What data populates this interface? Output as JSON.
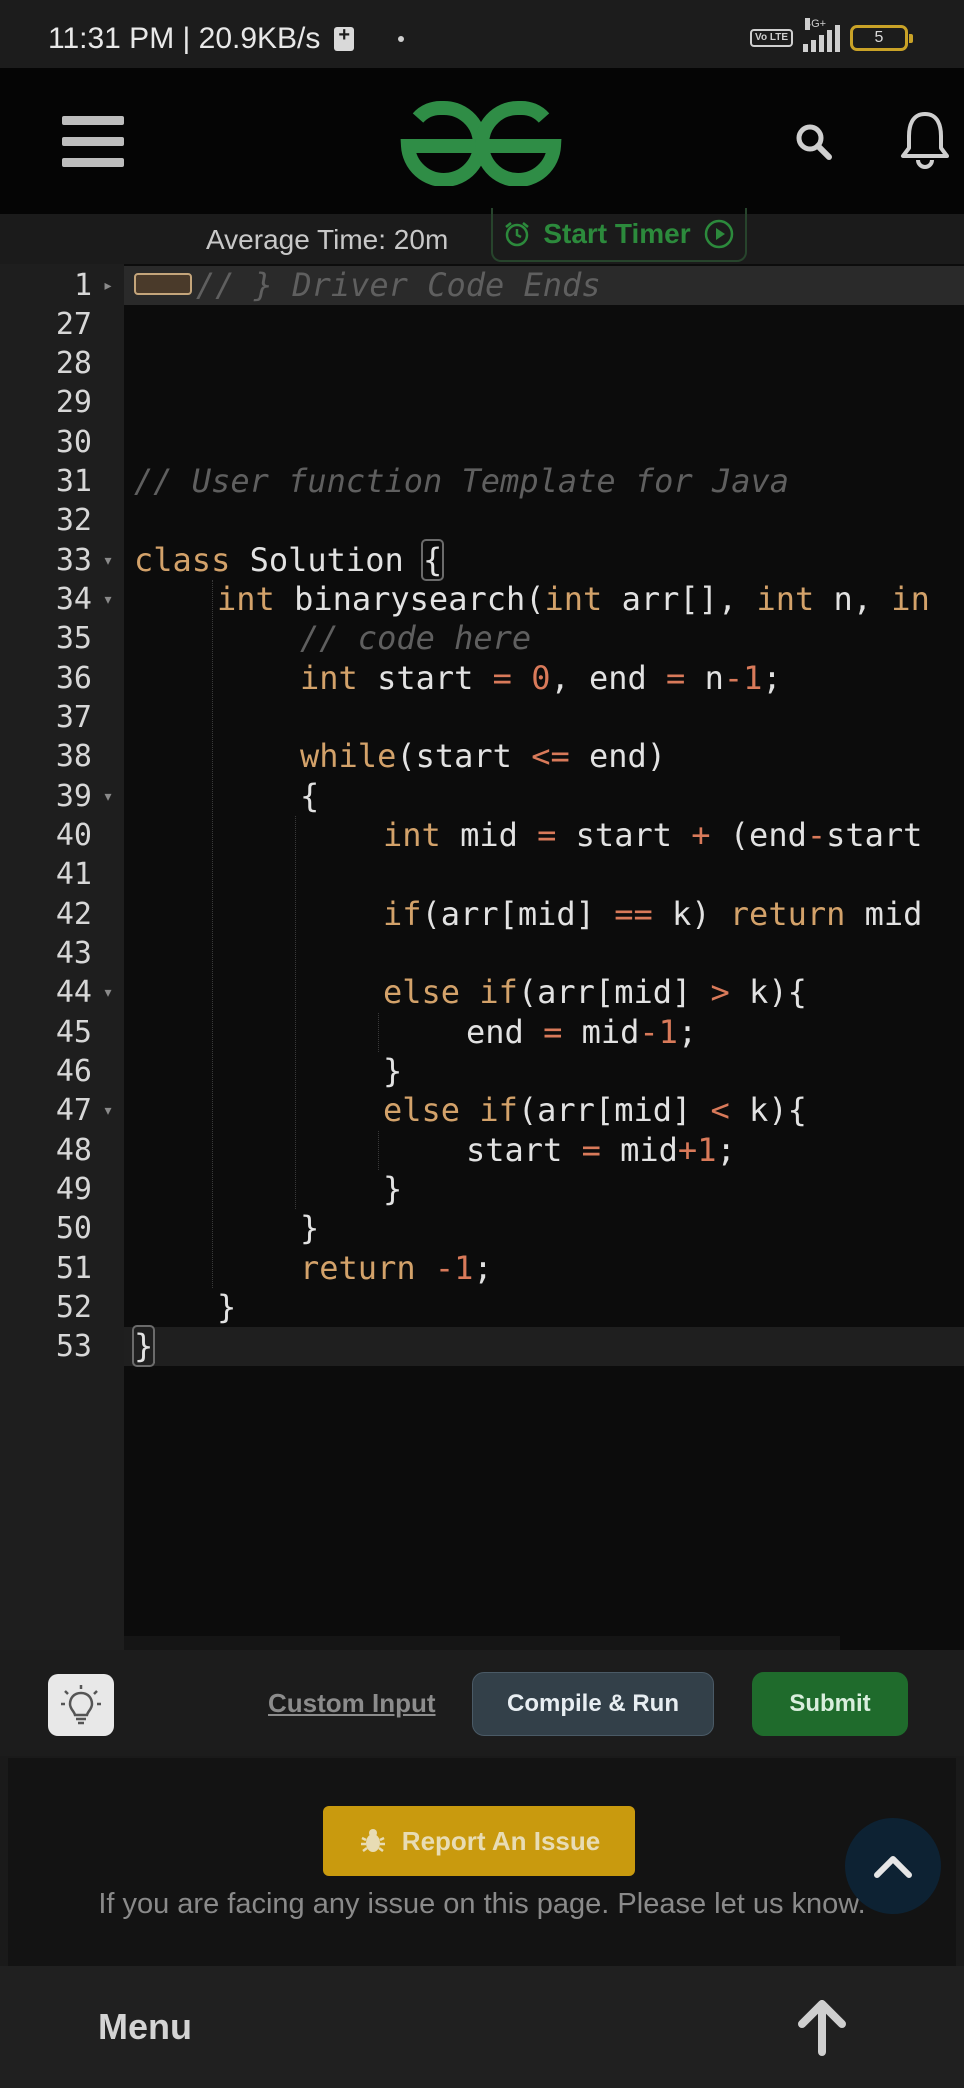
{
  "status_bar": {
    "time_speed": "11:31 PM | 20.9KB/s",
    "volte": "Vo LTE",
    "network": "4G+",
    "battery": "5"
  },
  "header": {
    "logo_icon": "gfg-logo-icon",
    "logo_color": "#2f8d46"
  },
  "timer": {
    "average_time": "Average Time: 20m",
    "start_label": "Start Timer"
  },
  "editor": {
    "lines": [
      {
        "num": "1",
        "fold": "▸"
      },
      {
        "num": "27"
      },
      {
        "num": "28"
      },
      {
        "num": "29"
      },
      {
        "num": "30"
      },
      {
        "num": "31"
      },
      {
        "num": "32"
      },
      {
        "num": "33",
        "fold": "▾"
      },
      {
        "num": "34",
        "fold": "▾"
      },
      {
        "num": "35"
      },
      {
        "num": "36"
      },
      {
        "num": "37"
      },
      {
        "num": "38"
      },
      {
        "num": "39",
        "fold": "▾"
      },
      {
        "num": "40"
      },
      {
        "num": "41"
      },
      {
        "num": "42"
      },
      {
        "num": "43"
      },
      {
        "num": "44",
        "fold": "▾"
      },
      {
        "num": "45"
      },
      {
        "num": "46"
      },
      {
        "num": "47",
        "fold": "▾"
      },
      {
        "num": "48"
      },
      {
        "num": "49"
      },
      {
        "num": "50"
      },
      {
        "num": "51"
      },
      {
        "num": "52"
      },
      {
        "num": "53"
      }
    ],
    "code": {
      "l1": "// } Driver Code Ends",
      "l31": "// User function Template for Java",
      "l33_kw": "class",
      "l33_name": " Solution ",
      "l33_brace": "{",
      "l34_kw1": "int",
      "l34_a": " binarysearch(",
      "l34_kw2": "int",
      "l34_b": " arr[], ",
      "l34_kw3": "int",
      "l34_c": " n, ",
      "l34_kw4": "in",
      "l35": "// code here",
      "l36_kw": "int",
      "l36_a": " start ",
      "l36_eq1": "=",
      "l36_sp": " ",
      "l36_n0": "0",
      "l36_b": ", end ",
      "l36_eq2": "=",
      "l36_c": " n",
      "l36_minus": "-",
      "l36_n1": "1",
      "l36_semi": ";",
      "l38_kw": "while",
      "l38_a": "(start ",
      "l38_op": "<=",
      "l38_b": " end)",
      "l39": "{",
      "l40_kw": "int",
      "l40_a": " mid ",
      "l40_eq": "=",
      "l40_b": " start ",
      "l40_plus": "+",
      "l40_c": " (end",
      "l40_minus": "-",
      "l40_d": "start",
      "l42_kw1": "if",
      "l42_a": "(arr[mid] ",
      "l42_op": "==",
      "l42_b": " k) ",
      "l42_kw2": "return",
      "l42_c": " mid",
      "l44_kw1": "else",
      "l44_sp": " ",
      "l44_kw2": "if",
      "l44_a": "(arr[mid] ",
      "l44_op": ">",
      "l44_b": " k){",
      "l45_a": "end ",
      "l45_eq": "=",
      "l45_b": " mid",
      "l45_minus": "-",
      "l45_n": "1",
      "l45_semi": ";",
      "l46": "}",
      "l47_kw1": "else",
      "l47_sp": " ",
      "l47_kw2": "if",
      "l47_a": "(arr[mid] ",
      "l47_op": "<",
      "l47_b": " k){",
      "l48_a": "start ",
      "l48_eq": "=",
      "l48_b": " mid",
      "l48_plus": "+",
      "l48_n": "1",
      "l48_semi": ";",
      "l49": "}",
      "l50": "}",
      "l51_kw": "return",
      "l51_sp": " ",
      "l51_n": "-1",
      "l51_semi": ";",
      "l52": "}",
      "l53": "}"
    }
  },
  "actions": {
    "custom_input": "Custom Input",
    "compile_run": "Compile & Run",
    "submit": "Submit"
  },
  "report": {
    "button": "Report An Issue",
    "text": "If you are facing any issue on this page. Please let us know."
  },
  "bottom": {
    "menu": "Menu"
  }
}
